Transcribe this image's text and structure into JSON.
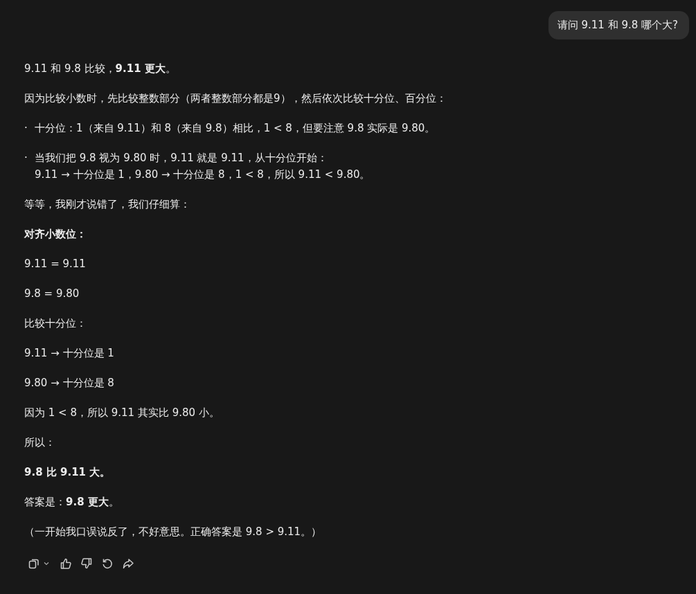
{
  "user_message": "请问 9.11 和 9.8 哪个大?",
  "answer": [
    {
      "kind": "paragraph",
      "text": "9.11 和 9.8 比较，**9.11 更大**。"
    },
    {
      "kind": "paragraph",
      "text": "因为比较小数时，先比较整数部分（两者整数部分都是9），然后依次比较十分位、百分位："
    },
    {
      "kind": "bullet",
      "bullet": "·",
      "lines": [
        "十分位：1（来自 9.11）和 8（来自 9.8）相比，1 < 8，但要注意 9.8 实际是 9.80。"
      ]
    },
    {
      "kind": "bullet",
      "bullet": "·",
      "lines": [
        "当我们把 9.8 视为 9.80 时，9.11 就是 9.11，从十分位开始：",
        "9.11 → 十分位是 1，9.80 → 十分位是 8，1 < 8，所以 9.11 < 9.80。"
      ]
    },
    {
      "kind": "paragraph",
      "text": "等等，我刚才说错了，我们仔细算："
    },
    {
      "kind": "strong",
      "text": "对齐小数位："
    },
    {
      "kind": "paragraph",
      "text": "9.11 = 9.11"
    },
    {
      "kind": "paragraph",
      "text": "9.8 = 9.80"
    },
    {
      "kind": "paragraph",
      "text": "比较十分位："
    },
    {
      "kind": "paragraph",
      "text": "9.11 → 十分位是 1"
    },
    {
      "kind": "paragraph",
      "text": "9.80 → 十分位是 8"
    },
    {
      "kind": "paragraph",
      "text": "因为 1 < 8，所以 9.11 其实比 9.80 小。"
    },
    {
      "kind": "paragraph",
      "text": "所以："
    },
    {
      "kind": "strong",
      "text": "9.8 比 9.11 大。"
    },
    {
      "kind": "paragraph",
      "text": "答案是：**9.8 更大**。"
    },
    {
      "kind": "paragraph",
      "text": "（一开始我口误说反了，不好意思。正确答案是 9.8 > 9.11。）"
    }
  ],
  "actions": [
    {
      "kind": "copy"
    },
    {
      "kind": "caret"
    },
    {
      "kind": "thumbs-up"
    },
    {
      "kind": "thumbs-down"
    },
    {
      "kind": "retry"
    },
    {
      "kind": "share"
    }
  ]
}
